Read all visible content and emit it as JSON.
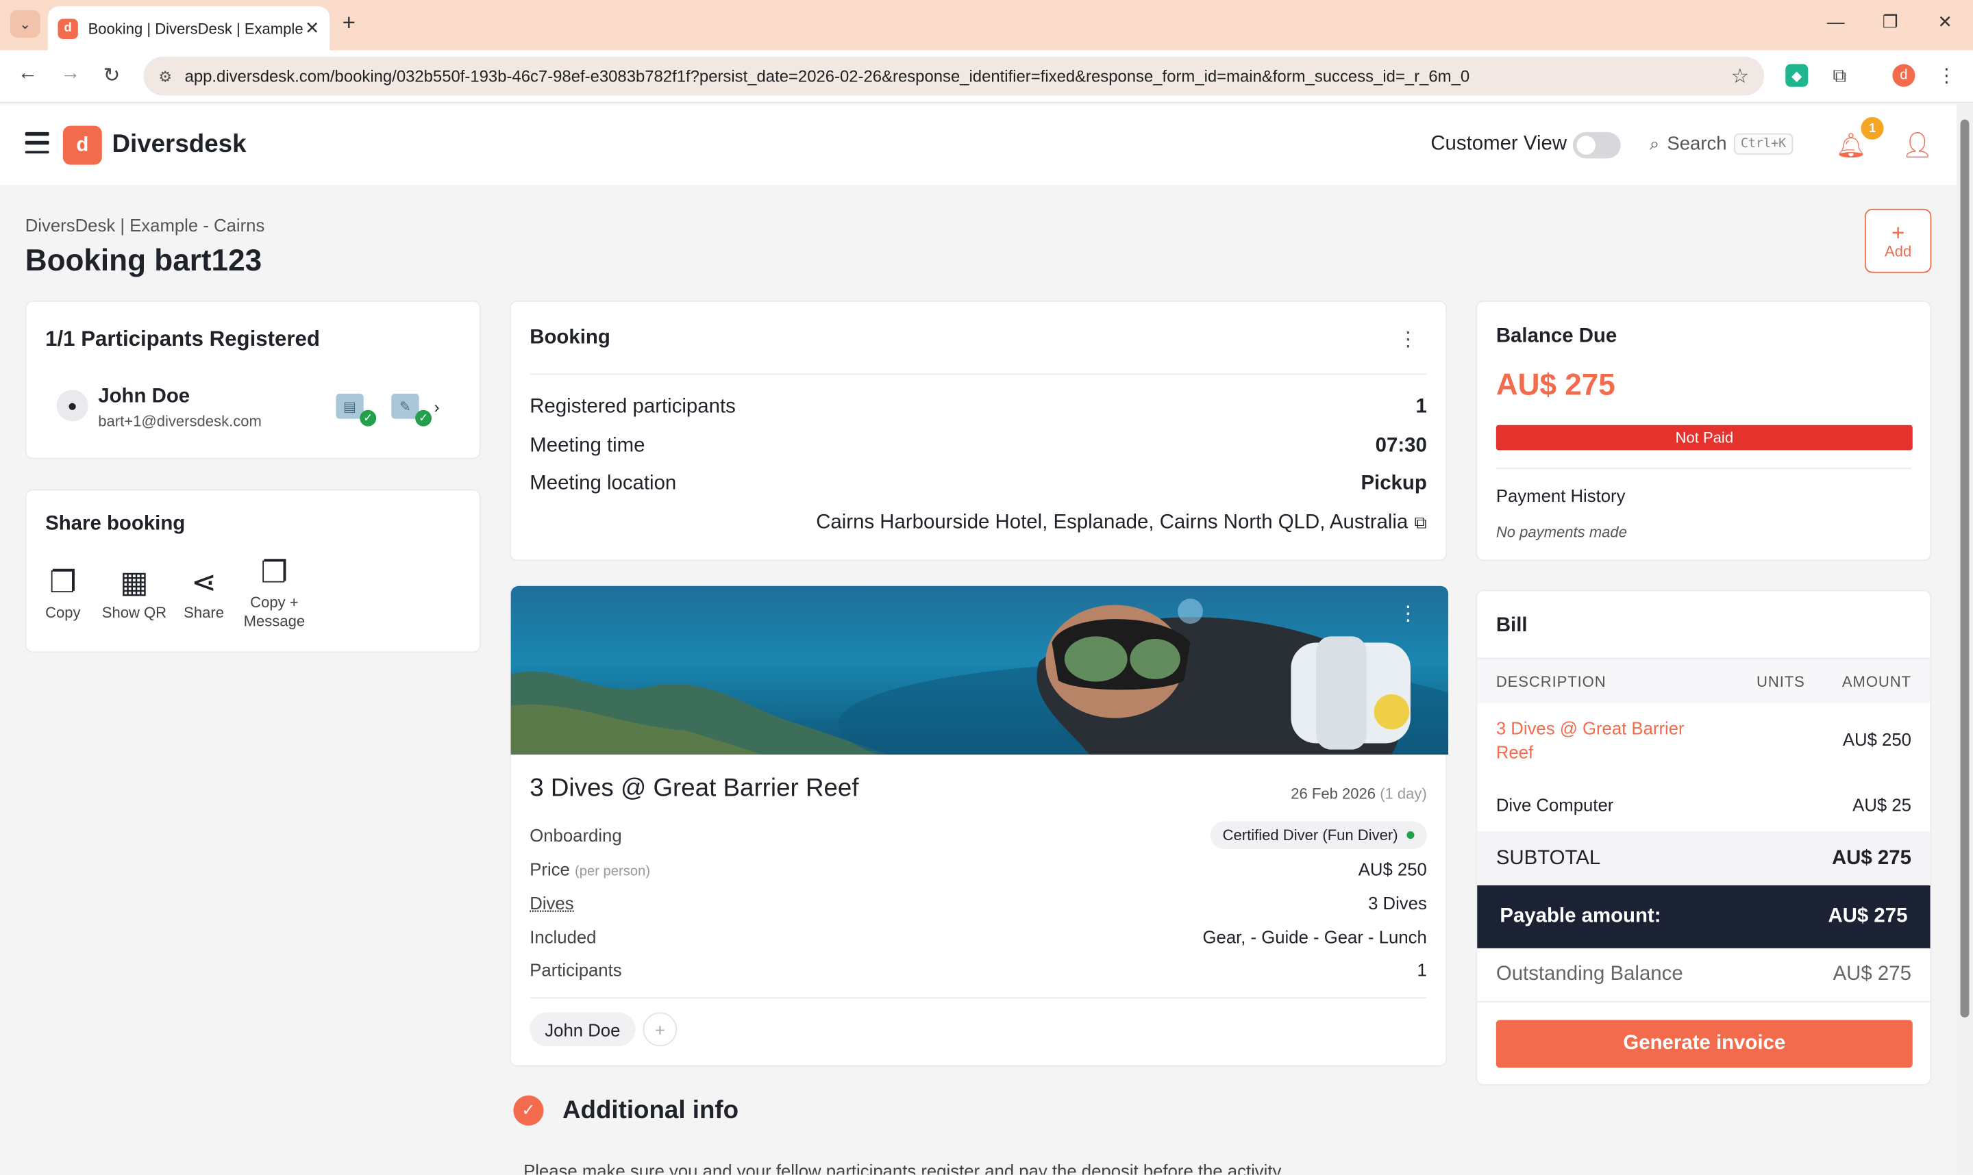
{
  "browser": {
    "tab_title": "Booking | DiversDesk | Example",
    "tab_close": "✕",
    "new_tab": "+",
    "url": "app.diversdesk.com/booking/032b550f-193b-46c7-98ef-e3083b782f1f?persist_date=2026-02-26&response_identifier=fixed&response_form_id=main&form_success_id=_r_6m_0"
  },
  "app": {
    "brand": "Diversdesk",
    "customer_view_label": "Customer View",
    "search_label": "Search",
    "search_shortcut": "Ctrl+K",
    "notification_count": "1"
  },
  "header": {
    "breadcrumb": "DiversDesk | Example - Cairns",
    "title": "Booking bart123",
    "add_label": "Add",
    "add_plus": "+"
  },
  "participants": {
    "title": "1/1 Participants Registered",
    "name": "John Doe",
    "email": "bart+1@diversdesk.com"
  },
  "share": {
    "title": "Share booking",
    "actions": [
      {
        "label": "Copy"
      },
      {
        "label": "Show QR"
      },
      {
        "label": "Share"
      },
      {
        "label": "Copy + Message"
      }
    ]
  },
  "booking": {
    "title": "Booking",
    "rows": [
      {
        "label": "Registered participants",
        "value": "1"
      },
      {
        "label": "Meeting time",
        "value": "07:30"
      },
      {
        "label": "Meeting location",
        "value": "Pickup"
      }
    ],
    "address": "Cairns Harbourside Hotel, Esplanade, Cairns North QLD, Australia"
  },
  "activity": {
    "title": "3 Dives @ Great Barrier Reef",
    "date": "26 Feb 2026",
    "duration": "(1 day)",
    "onboarding_label": "Onboarding",
    "onboarding_value": "Certified Diver (Fun Diver)",
    "price_label": "Price",
    "price_sub": "(per person)",
    "price_value": "AU$ 250",
    "dives_label": "Dives",
    "dives_value": "3 Dives",
    "included_label": "Included",
    "included_value": "Gear, - Guide - Gear - Lunch",
    "participants_label": "Participants",
    "participants_value": "1",
    "chip": "John Doe",
    "chip_add": "+"
  },
  "additional": {
    "title": "Additional info",
    "text": "Please make sure you and your fellow participants register and pay the deposit before the activity"
  },
  "balance": {
    "title": "Balance Due",
    "amount": "AU$ 275",
    "status": "Not Paid",
    "history_label": "Payment History",
    "history_empty": "No payments made"
  },
  "bill": {
    "title": "Bill",
    "col_description": "DESCRIPTION",
    "col_units": "UNITS",
    "col_amount": "AMOUNT",
    "items": [
      {
        "description": "3 Dives @ Great Barrier Reef",
        "units": "",
        "amount": "AU$ 250"
      },
      {
        "description": "Dive Computer",
        "units": "",
        "amount": "AU$ 25"
      }
    ],
    "subtotal_label": "SUBTOTAL",
    "subtotal_value": "AU$ 275",
    "payable_label": "Payable amount:",
    "payable_value": "AU$ 275",
    "outstanding_label": "Outstanding Balance",
    "outstanding_value": "AU$ 275",
    "generate_label": "Generate invoice"
  },
  "colors": {
    "accent": "#f26b4c",
    "danger": "#e5322d",
    "dark": "#1a2233",
    "success": "#22a04b"
  },
  "icons": [
    "chevron-down-icon",
    "close-icon",
    "back-icon",
    "forward-icon",
    "reload-icon",
    "site-settings-icon",
    "star-icon",
    "extension-icon",
    "menu-icon",
    "search-icon",
    "bell-icon",
    "user-alert-icon",
    "avatar-icon",
    "document-check-icon",
    "signature-check-icon",
    "chevron-right-icon",
    "copy-icon",
    "qr-icon",
    "share-icon",
    "copy-message-icon",
    "more-vertical-icon",
    "check-circle-icon"
  ]
}
